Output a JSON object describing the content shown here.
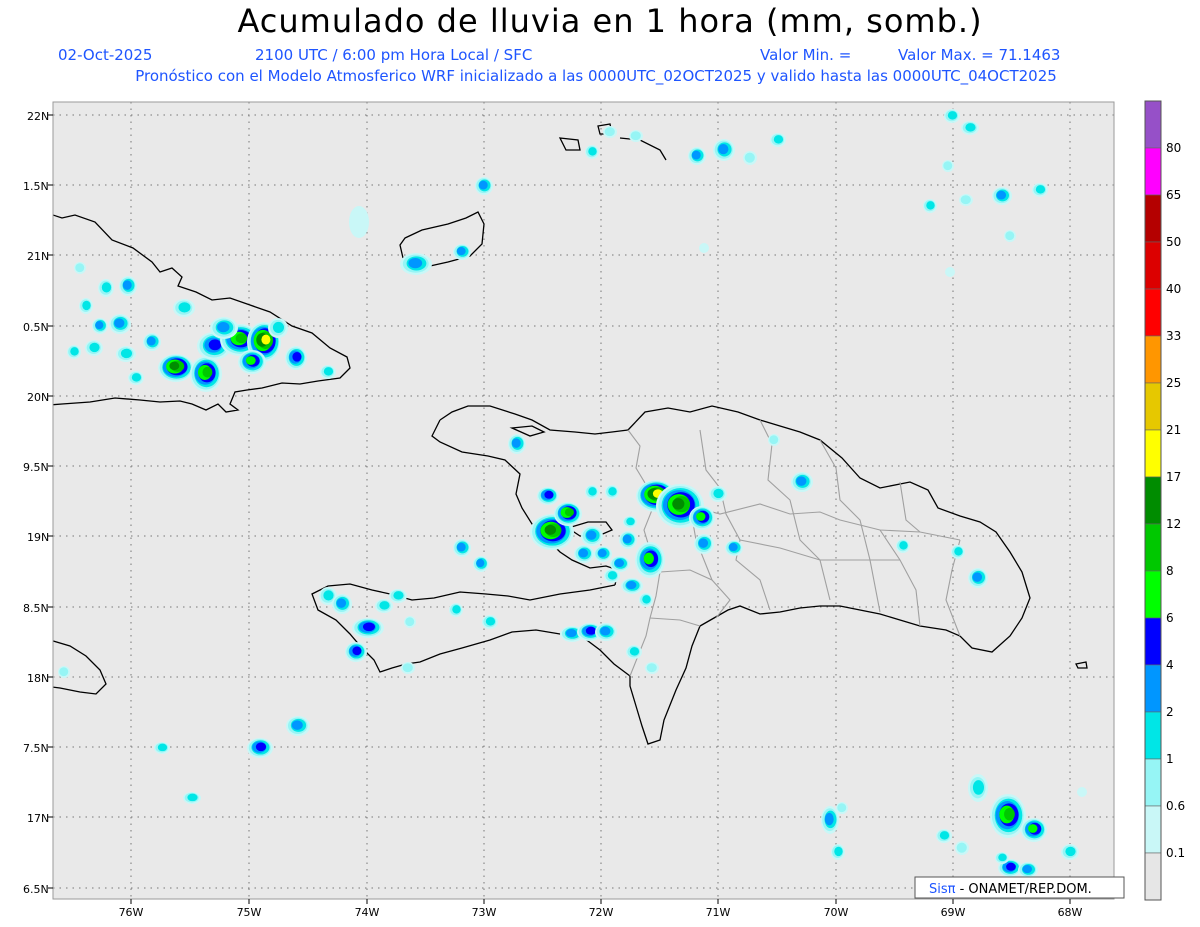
{
  "header": {
    "title": "Acumulado de lluvia en 1 hora (mm, somb.)",
    "date": "02-Oct-2025",
    "valid_time": "2100 UTC / 6:00 pm Hora Local / SFC",
    "valor_min": "Valor Min. =",
    "valor_max": "Valor Max. = 71.1463",
    "subtitle": "Pronóstico con el Modelo Atmosferico WRF inicializado a las 0000UTC_02OCT2025 y valido hasta las  0000UTC_04OCT2025"
  },
  "map": {
    "lat_ticks": [
      "22N",
      "1.5N",
      "21N",
      "0.5N",
      "20N",
      "9.5N",
      "19N",
      "8.5N",
      "18N",
      "7.5N",
      "17N",
      "6.5N"
    ],
    "lon_ticks": [
      "76W",
      "75W",
      "74W",
      "73W",
      "72W",
      "71W",
      "70W",
      "69W",
      "68W"
    ],
    "credit_brand": "Sisπ",
    "credit_text": " - ONAMET/REP.DOM."
  },
  "colorbar": {
    "levels": [
      "0.1",
      "0.6",
      "1",
      "2",
      "4",
      "6",
      "8",
      "12",
      "17",
      "21",
      "25",
      "33",
      "40",
      "50",
      "65",
      "80"
    ],
    "colors": [
      "#e6e6e6",
      "#c9f7f7",
      "#96f5f5",
      "#00e6e6",
      "#0096ff",
      "#0000ff",
      "#00ff00",
      "#00c800",
      "#008c00",
      "#ffff00",
      "#e6c800",
      "#ff9600",
      "#ff0000",
      "#dc0000",
      "#b40000",
      "#ff00ff",
      "#9650c8"
    ]
  },
  "style": {
    "map_bg": "#e9e9e9",
    "coast": "#000000",
    "border": "#a0a0a0",
    "grid": "#707070",
    "accent_blue": "#1e55ff"
  }
}
